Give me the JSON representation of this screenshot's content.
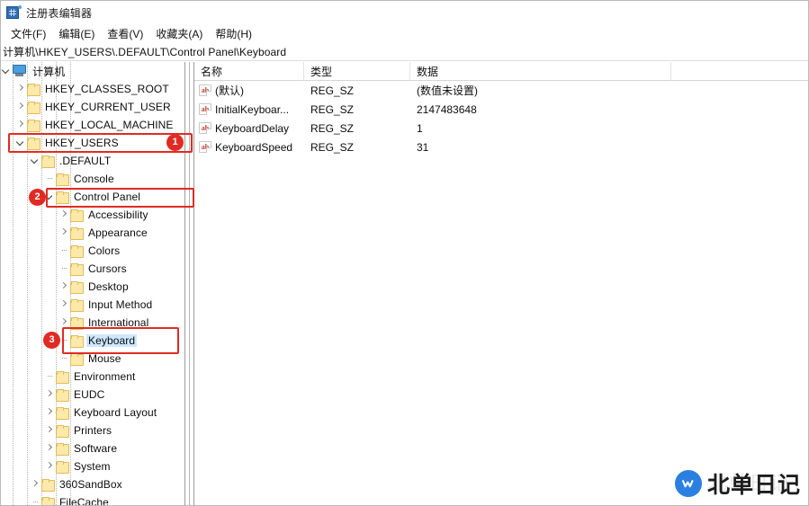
{
  "window": {
    "title": "注册表编辑器",
    "icon": "registry-editor-icon"
  },
  "menubar": {
    "items": [
      {
        "label": "文件(F)"
      },
      {
        "label": "编辑(E)"
      },
      {
        "label": "查看(V)"
      },
      {
        "label": "收藏夹(A)"
      },
      {
        "label": "帮助(H)"
      }
    ]
  },
  "addressbar": {
    "path": "计算机\\HKEY_USERS\\.DEFAULT\\Control Panel\\Keyboard"
  },
  "tree": {
    "items": [
      {
        "label": "计算机",
        "depth": 0,
        "state": "expanded",
        "icon": "computer-icon",
        "selected": false
      },
      {
        "label": "HKEY_CLASSES_ROOT",
        "depth": 1,
        "state": "collapsed",
        "icon": "folder-icon",
        "selected": false
      },
      {
        "label": "HKEY_CURRENT_USER",
        "depth": 1,
        "state": "collapsed",
        "icon": "folder-icon",
        "selected": false
      },
      {
        "label": "HKEY_LOCAL_MACHINE",
        "depth": 1,
        "state": "collapsed",
        "icon": "folder-icon",
        "selected": false
      },
      {
        "label": "HKEY_USERS",
        "depth": 1,
        "state": "expanded",
        "icon": "folder-icon",
        "selected": false
      },
      {
        "label": ".DEFAULT",
        "depth": 2,
        "state": "expanded",
        "icon": "folder-icon",
        "selected": false
      },
      {
        "label": "Console",
        "depth": 3,
        "state": "leaf",
        "icon": "folder-icon",
        "selected": false
      },
      {
        "label": "Control Panel",
        "depth": 3,
        "state": "expanded",
        "icon": "folder-icon",
        "selected": false
      },
      {
        "label": "Accessibility",
        "depth": 4,
        "state": "collapsed",
        "icon": "folder-icon",
        "selected": false
      },
      {
        "label": "Appearance",
        "depth": 4,
        "state": "collapsed",
        "icon": "folder-icon",
        "selected": false
      },
      {
        "label": "Colors",
        "depth": 4,
        "state": "leaf",
        "icon": "folder-icon",
        "selected": false
      },
      {
        "label": "Cursors",
        "depth": 4,
        "state": "leaf",
        "icon": "folder-icon",
        "selected": false
      },
      {
        "label": "Desktop",
        "depth": 4,
        "state": "collapsed",
        "icon": "folder-icon",
        "selected": false
      },
      {
        "label": "Input Method",
        "depth": 4,
        "state": "collapsed",
        "icon": "folder-icon",
        "selected": false
      },
      {
        "label": "International",
        "depth": 4,
        "state": "collapsed",
        "icon": "folder-icon",
        "selected": false
      },
      {
        "label": "Keyboard",
        "depth": 4,
        "state": "leaf",
        "icon": "folder-icon",
        "selected": true
      },
      {
        "label": "Mouse",
        "depth": 4,
        "state": "leaf",
        "icon": "folder-icon",
        "selected": false
      },
      {
        "label": "Environment",
        "depth": 3,
        "state": "leaf",
        "icon": "folder-icon",
        "selected": false
      },
      {
        "label": "EUDC",
        "depth": 3,
        "state": "collapsed",
        "icon": "folder-icon",
        "selected": false
      },
      {
        "label": "Keyboard Layout",
        "depth": 3,
        "state": "collapsed",
        "icon": "folder-icon",
        "selected": false
      },
      {
        "label": "Printers",
        "depth": 3,
        "state": "collapsed",
        "icon": "folder-icon",
        "selected": false
      },
      {
        "label": "Software",
        "depth": 3,
        "state": "collapsed",
        "icon": "folder-icon",
        "selected": false
      },
      {
        "label": "System",
        "depth": 3,
        "state": "collapsed",
        "icon": "folder-icon",
        "selected": false
      },
      {
        "label": "360SandBox",
        "depth": 2,
        "state": "collapsed",
        "icon": "folder-icon",
        "selected": false
      },
      {
        "label": "FileCache",
        "depth": 2,
        "state": "leaf",
        "icon": "folder-icon",
        "selected": false
      }
    ]
  },
  "list": {
    "columns": [
      {
        "label": "名称"
      },
      {
        "label": "类型"
      },
      {
        "label": "数据"
      }
    ],
    "rows": [
      {
        "name": "(默认)",
        "type": "REG_SZ",
        "data": "(数值未设置)",
        "icon": "string-value-icon"
      },
      {
        "name": "InitialKeyboar...",
        "type": "REG_SZ",
        "data": "2147483648",
        "icon": "string-value-icon"
      },
      {
        "name": "KeyboardDelay",
        "type": "REG_SZ",
        "data": "1",
        "icon": "string-value-icon"
      },
      {
        "name": "KeyboardSpeed",
        "type": "REG_SZ",
        "data": "31",
        "icon": "string-value-icon"
      }
    ]
  },
  "annotations": {
    "color": "#e02b24",
    "badges": [
      {
        "number": "1",
        "target": "HKEY_USERS"
      },
      {
        "number": "2",
        "target": "Control Panel"
      },
      {
        "number": "3",
        "target": "Keyboard"
      }
    ]
  },
  "watermark": {
    "text": "北单日记",
    "logo": "w-logo-icon"
  }
}
